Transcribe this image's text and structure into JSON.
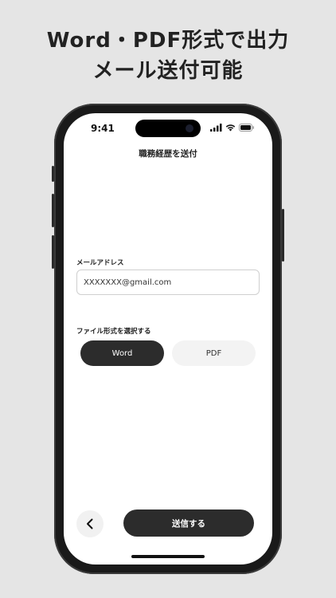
{
  "headline": {
    "line1": "Word・PDF形式で出力",
    "line2": "メール送付可能"
  },
  "status_bar": {
    "time": "9:41",
    "icons": [
      "cellular-signal-icon",
      "wifi-icon",
      "battery-icon"
    ]
  },
  "screen": {
    "title": "職務経歴を送付",
    "email_label": "メールアドレス",
    "email_value": "XXXXXXX@gmail.com",
    "format_label": "ファイル形式を選択する",
    "formats": [
      {
        "label": "Word",
        "selected": true
      },
      {
        "label": "PDF",
        "selected": false
      }
    ],
    "back_icon": "chevron-left-icon",
    "send_label": "送信する"
  },
  "colors": {
    "background": "#e5e5e5",
    "accent_dark": "#2c2c2c",
    "unselected": "#f3f3f3"
  }
}
